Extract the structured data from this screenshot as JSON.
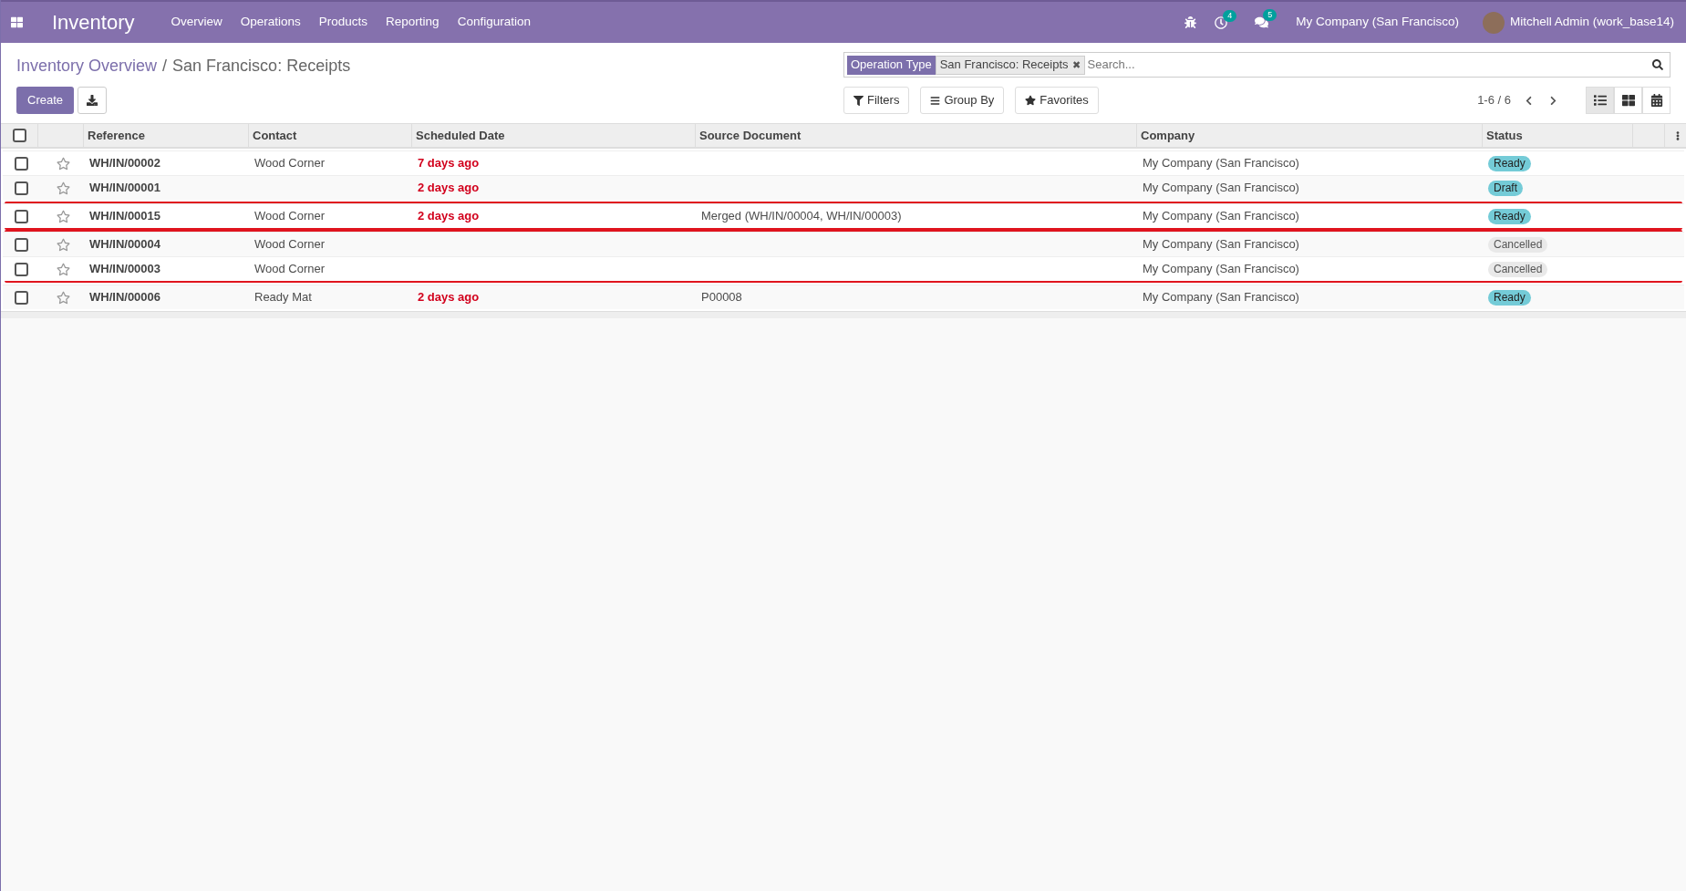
{
  "navbar": {
    "app_title": "Inventory",
    "menu": [
      "Overview",
      "Operations",
      "Products",
      "Reporting",
      "Configuration"
    ],
    "activity_count": "4",
    "message_count": "5",
    "company": "My Company (San Francisco)",
    "user": "Mitchell Admin (work_base14)"
  },
  "breadcrumb": {
    "parent": "Inventory Overview",
    "separator": "/",
    "current": "San Francisco: Receipts"
  },
  "buttons": {
    "create": "Create"
  },
  "search": {
    "facet_label": "Operation Type",
    "facet_value": "San Francisco: Receipts",
    "facet_remove": "✖",
    "placeholder": "Search..."
  },
  "filters": [
    "Filters",
    "Group By",
    "Favorites"
  ],
  "pager": "1-6 / 6",
  "views": [
    {
      "kind": "list",
      "selected": true
    },
    {
      "kind": "kanban",
      "selected": false
    },
    {
      "kind": "calendar",
      "selected": false
    }
  ],
  "table": {
    "all_checked": false,
    "columns": [
      "Reference",
      "Contact",
      "Scheduled Date",
      "Source Document",
      "Company",
      "Status"
    ],
    "blocks": [
      {
        "outlined": false,
        "rows": [
          {
            "reference": "WH/IN/00002",
            "contact": "Wood Corner",
            "scheduled": "7 days ago",
            "source": "",
            "company": "My Company (San Francisco)",
            "status": "Ready",
            "kind": "ready",
            "checked": false,
            "starred": false
          },
          {
            "reference": "WH/IN/00001",
            "contact": "",
            "scheduled": "2 days ago",
            "source": "",
            "company": "My Company (San Francisco)",
            "status": "Draft",
            "kind": "draft",
            "checked": false,
            "starred": false
          }
        ]
      },
      {
        "outlined": true,
        "rows": [
          {
            "reference": "WH/IN/00015",
            "contact": "Wood Corner",
            "scheduled": "2 days ago",
            "source": "Merged (WH/IN/00004, WH/IN/00003)",
            "company": "My Company (San Francisco)",
            "status": "Ready",
            "kind": "ready",
            "checked": false,
            "starred": false
          }
        ]
      },
      {
        "outlined": true,
        "rows": [
          {
            "reference": "WH/IN/00004",
            "contact": "Wood Corner",
            "scheduled": "",
            "source": "",
            "company": "My Company (San Francisco)",
            "status": "Cancelled",
            "kind": "cancelled",
            "checked": false,
            "starred": false
          },
          {
            "reference": "WH/IN/00003",
            "contact": "Wood Corner",
            "scheduled": "",
            "source": "",
            "company": "My Company (San Francisco)",
            "status": "Cancelled",
            "kind": "cancelled",
            "checked": false,
            "starred": false
          }
        ]
      },
      {
        "outlined": false,
        "rows": [
          {
            "reference": "WH/IN/00006",
            "contact": "Ready Mat",
            "scheduled": "2 days ago",
            "source": "P00008",
            "company": "My Company (San Francisco)",
            "status": "Ready",
            "kind": "ready",
            "checked": false,
            "starred": false
          }
        ]
      }
    ]
  }
}
